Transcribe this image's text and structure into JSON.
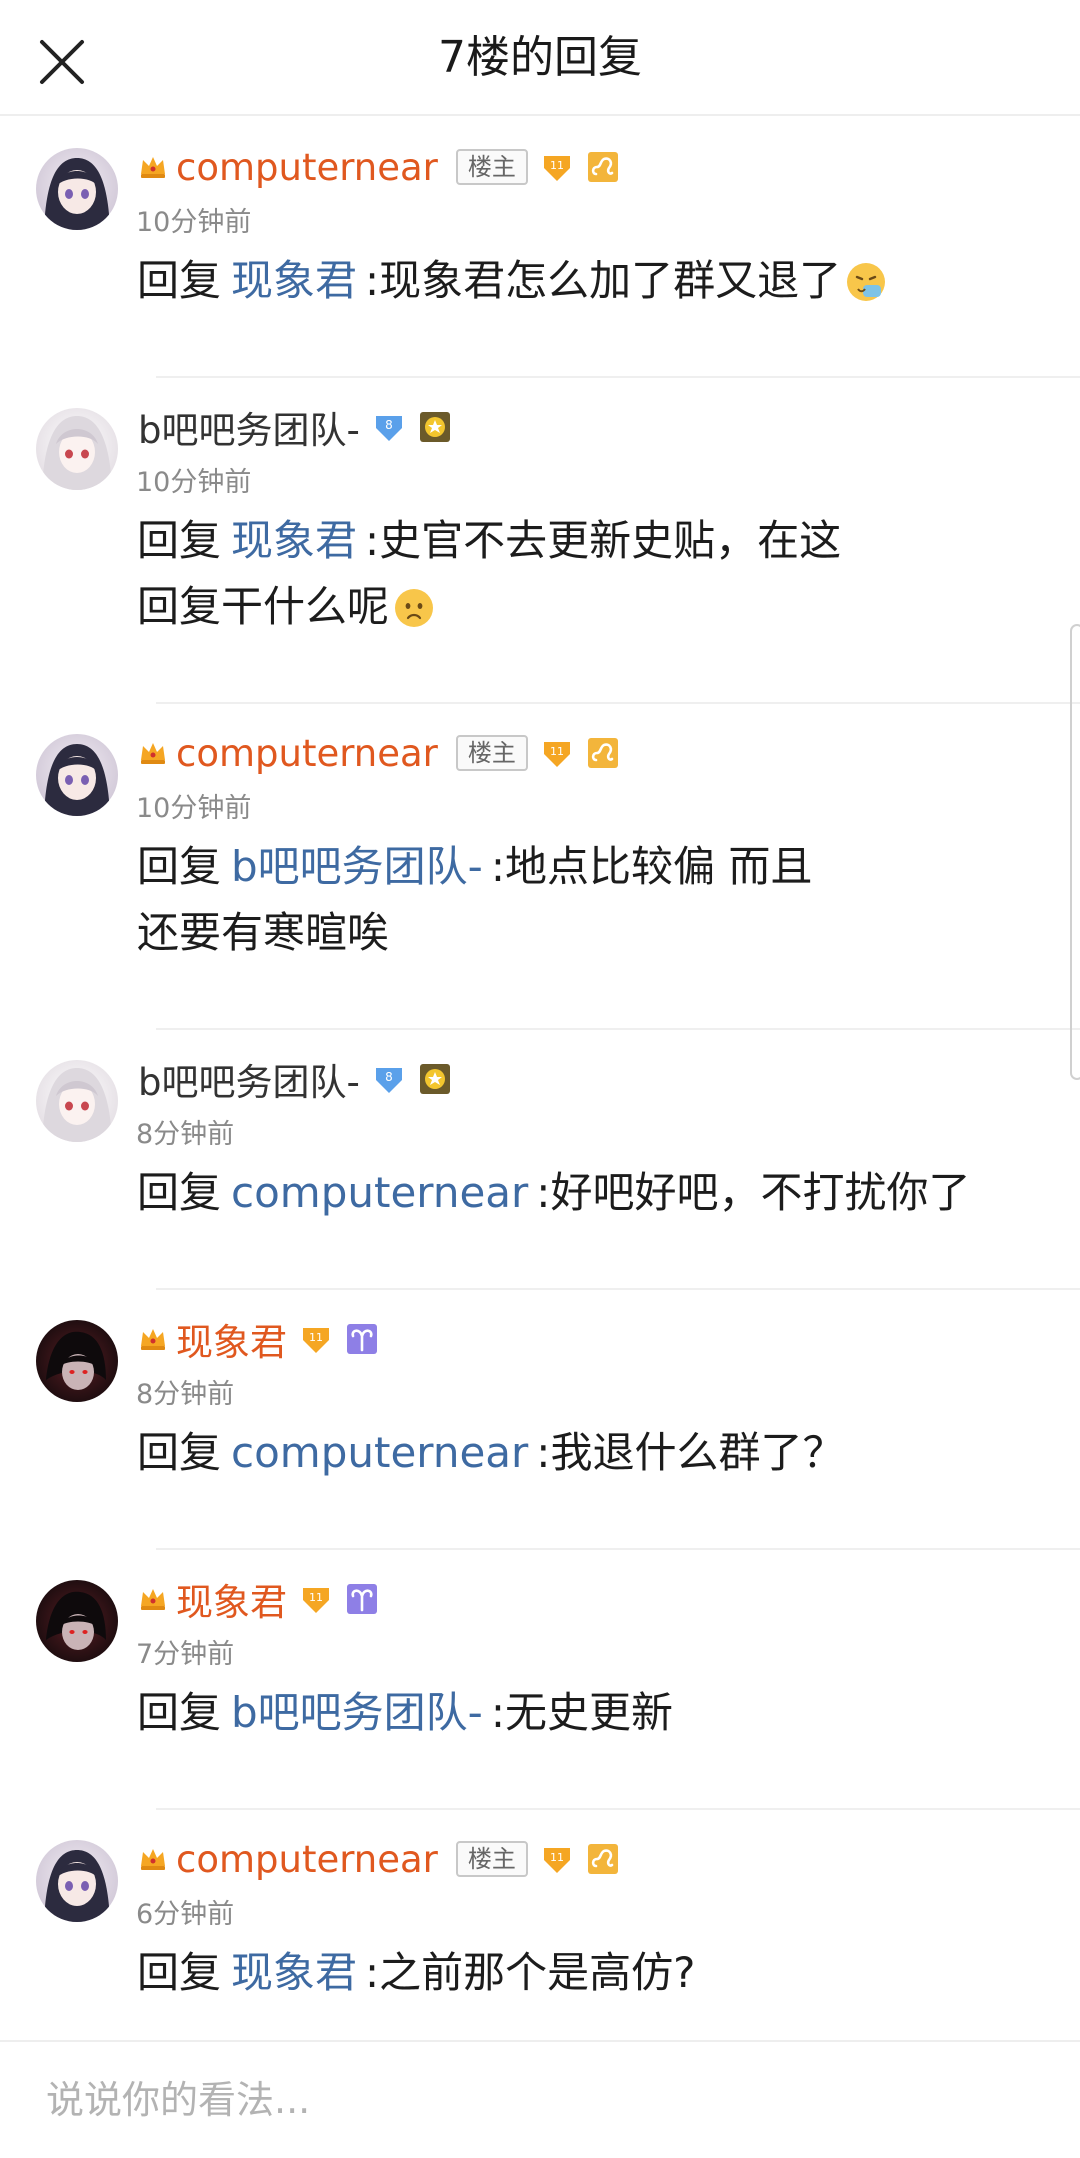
{
  "header": {
    "title": "7楼的回复",
    "close_icon": "close-icon"
  },
  "replies": [
    {
      "user": "computernear",
      "is_host": true,
      "host_badge": "楼主",
      "time": "10分钟前",
      "reply_label": "回复",
      "mention": "现象君",
      "line1": ":现象君怎么加了群又退了",
      "line2": "",
      "badges": [
        "level-11-icon",
        "leo-icon"
      ],
      "emoji": "sneeze-emoji"
    },
    {
      "user": "b吧吧务团队-",
      "is_host": false,
      "host_badge": "",
      "time": "10分钟前",
      "reply_label": "回复",
      "mention": "现象君",
      "line1": ":史官不去更新史贴，在这",
      "line2": "回复干什么呢",
      "badges": [
        "level-8-icon",
        "moderator-icon"
      ],
      "emoji": "worried-emoji"
    },
    {
      "user": "computernear",
      "is_host": true,
      "host_badge": "楼主",
      "time": "10分钟前",
      "reply_label": "回复",
      "mention": "b吧吧务团队-",
      "line1": ":地点比较偏 而且",
      "line2": "还要有寒暄唉",
      "badges": [
        "level-11-icon",
        "leo-icon"
      ],
      "emoji": ""
    },
    {
      "user": "b吧吧务团队-",
      "is_host": false,
      "host_badge": "",
      "time": "8分钟前",
      "reply_label": "回复",
      "mention": "computernear",
      "line1": ":好吧好吧，不打扰你了",
      "line2": "",
      "badges": [
        "level-8-icon",
        "moderator-icon"
      ],
      "emoji": ""
    },
    {
      "user": "现象君",
      "is_host": false,
      "host_badge": "",
      "time": "8分钟前",
      "reply_label": "回复",
      "mention": "computernear",
      "line1": ":我退什么群了？",
      "line2": "",
      "badges": [
        "level-11-icon",
        "aries-icon"
      ],
      "emoji": ""
    },
    {
      "user": "现象君",
      "is_host": false,
      "host_badge": "",
      "time": "7分钟前",
      "reply_label": "回复",
      "mention": "b吧吧务团队-",
      "line1": ":无史更新",
      "line2": "",
      "badges": [
        "level-11-icon",
        "aries-icon"
      ],
      "emoji": ""
    },
    {
      "user": "computernear",
      "is_host": true,
      "host_badge": "楼主",
      "time": "6分钟前",
      "reply_label": "回复",
      "mention": "现象君",
      "line1": ":之前那个是高仿?",
      "line2": "",
      "badges": [
        "level-11-icon",
        "leo-icon"
      ],
      "emoji": ""
    }
  ],
  "comment_box": {
    "placeholder": "说说你的看法..."
  },
  "badge_text": {
    "level_11": "11",
    "level_8": "8"
  },
  "colors": {
    "host_name": "#e0581f",
    "mention": "#3e6aa2",
    "time": "#8a8a8a",
    "level_gold": "#f5a623",
    "level_blue": "#4a90e2",
    "aries_purple": "#8b7be8"
  }
}
